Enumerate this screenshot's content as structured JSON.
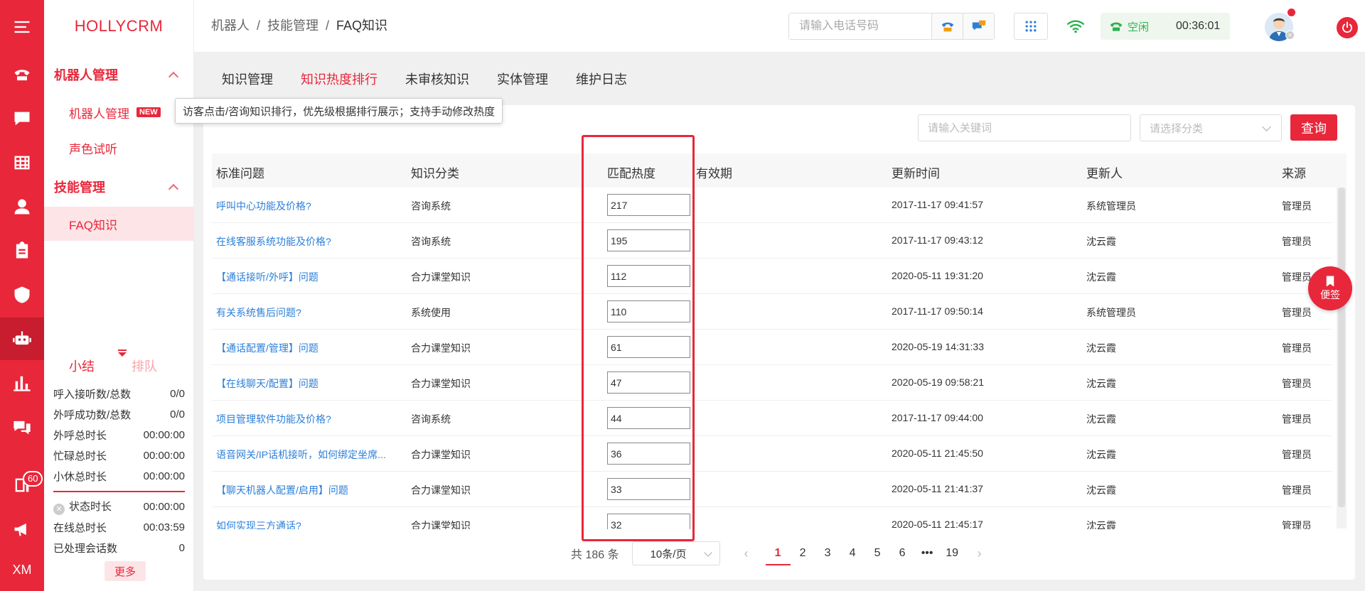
{
  "app": {
    "logo": "HOLLYCRM"
  },
  "rail": {
    "badge_count": "60",
    "user_initials": "XM"
  },
  "sidebar": {
    "groups": [
      {
        "label": "机器人管理",
        "items": [
          {
            "label": "机器人管理",
            "badge": "NEW"
          },
          {
            "label": "声色试听"
          }
        ]
      },
      {
        "label": "技能管理",
        "items": [
          {
            "label": "FAQ知识"
          }
        ]
      }
    ],
    "stats": {
      "tabs": [
        "小结",
        "排队"
      ],
      "rows": [
        {
          "label": "呼入接听数/总数",
          "value": "0/0"
        },
        {
          "label": "外呼成功数/总数",
          "value": "0/0"
        },
        {
          "label": "外呼总时长",
          "value": "00:00:00"
        },
        {
          "label": "忙碌总时长",
          "value": "00:00:00"
        },
        {
          "label": "小休总时长",
          "value": "00:00:00"
        }
      ],
      "rows2": [
        {
          "label": "状态时长",
          "value": "00:00:00"
        },
        {
          "label": "在线总时长",
          "value": "00:03:59"
        },
        {
          "label": "已处理会话数",
          "value": "0"
        }
      ],
      "more": "更多"
    }
  },
  "header": {
    "breadcrumb": [
      "机器人",
      "技能管理",
      "FAQ知识"
    ],
    "phone_placeholder": "请输入电话号码",
    "status": "空闲",
    "timer": "00:36:01"
  },
  "tabs": [
    "知识管理",
    "知识热度排行",
    "未审核知识",
    "实体管理",
    "维护日志"
  ],
  "tooltip": "访客点击/咨询知识排行，优先级根据排行展示；支持手动修改热度",
  "filters": {
    "keyword_placeholder": "请输入关键词",
    "category_placeholder": "请选择分类",
    "query": "查询"
  },
  "table": {
    "columns": [
      "标准问题",
      "知识分类",
      "匹配热度",
      "有效期",
      "更新时间",
      "更新人",
      "来源"
    ],
    "rows": [
      {
        "q": "呼叫中心功能及价格?",
        "cat": "咨询系统",
        "heat": "217",
        "time": "2017-11-17 09:41:57",
        "user": "系统管理员",
        "src": "管理员"
      },
      {
        "q": "在线客服系统功能及价格?",
        "cat": "咨询系统",
        "heat": "195",
        "time": "2017-11-17 09:43:12",
        "user": "沈云霞",
        "src": "管理员"
      },
      {
        "q": "【通话接听/外呼】问题",
        "cat": "合力课堂知识",
        "heat": "112",
        "time": "2020-05-11 19:31:20",
        "user": "沈云霞",
        "src": "管理员"
      },
      {
        "q": "有关系统售后问题?",
        "cat": "系统使用",
        "heat": "110",
        "time": "2017-11-17 09:50:14",
        "user": "系统管理员",
        "src": "管理员"
      },
      {
        "q": "【通话配置/管理】问题",
        "cat": "合力课堂知识",
        "heat": "61",
        "time": "2020-05-19 14:31:33",
        "user": "沈云霞",
        "src": "管理员"
      },
      {
        "q": "【在线聊天/配置】问题",
        "cat": "合力课堂知识",
        "heat": "47",
        "time": "2020-05-19 09:58:21",
        "user": "沈云霞",
        "src": "管理员"
      },
      {
        "q": "项目管理软件功能及价格?",
        "cat": "咨询系统",
        "heat": "44",
        "time": "2017-11-17 09:44:00",
        "user": "沈云霞",
        "src": "管理员"
      },
      {
        "q": "语音网关/IP话机接听，如何绑定坐席...",
        "cat": "合力课堂知识",
        "heat": "36",
        "time": "2020-05-11 21:45:50",
        "user": "沈云霞",
        "src": "管理员"
      },
      {
        "q": "【聊天机器人配置/启用】问题",
        "cat": "合力课堂知识",
        "heat": "33",
        "time": "2020-05-11 21:41:37",
        "user": "沈云霞",
        "src": "管理员"
      },
      {
        "q": "如何实现三方通话?",
        "cat": "合力课堂知识",
        "heat": "32",
        "time": "2020-05-11 21:45:17",
        "user": "沈云霞",
        "src": "管理员"
      }
    ]
  },
  "fab": "便签",
  "pager": {
    "total": "共 186 条",
    "size": "10条/页",
    "pages": [
      "1",
      "2",
      "3",
      "4",
      "5",
      "6",
      "•••",
      "19"
    ],
    "current": "1"
  },
  "colors": {
    "brand": "#e8273a",
    "link": "#2b7fd8",
    "status_green": "#2bb24c"
  }
}
